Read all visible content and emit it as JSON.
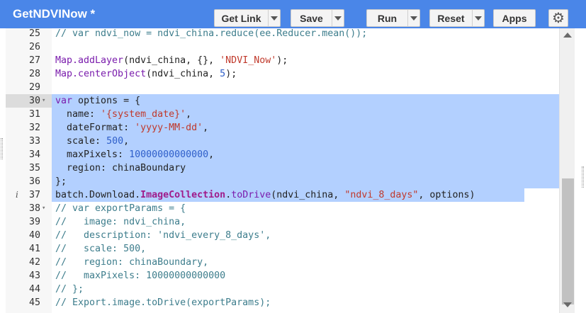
{
  "header": {
    "title": "GetNDVINow *",
    "get_link_label": "Get Link",
    "save_label": "Save",
    "run_label": "Run",
    "reset_label": "Reset",
    "apps_label": "Apps",
    "settings_icon": "gear-icon",
    "color": "#4a86e8"
  },
  "editor": {
    "selection_color": "#b3d0ff",
    "lines": [
      {
        "num": "25",
        "fold": "",
        "marker": "",
        "selected": false,
        "tokens": [
          [
            "com",
            "// var ndvi_now = ndvi_china.reduce(ee.Reducer.mean());"
          ]
        ]
      },
      {
        "num": "26",
        "fold": "",
        "marker": "",
        "selected": false,
        "tokens": []
      },
      {
        "num": "27",
        "fold": "",
        "marker": "",
        "selected": false,
        "tokens": [
          [
            "fn",
            "Map.addLayer"
          ],
          [
            "plain",
            "(ndvi_china, {}, "
          ],
          [
            "str",
            "'NDVI_Now'"
          ],
          [
            "plain",
            ");"
          ]
        ]
      },
      {
        "num": "28",
        "fold": "",
        "marker": "",
        "selected": false,
        "tokens": [
          [
            "fn",
            "Map.centerObject"
          ],
          [
            "plain",
            "(ndvi_china, "
          ],
          [
            "num",
            "5"
          ],
          [
            "plain",
            ");"
          ]
        ]
      },
      {
        "num": "29",
        "fold": "",
        "marker": "",
        "selected": false,
        "tokens": []
      },
      {
        "num": "30",
        "fold": "▾",
        "marker": "",
        "selected": true,
        "tokens": [
          [
            "kw",
            "var"
          ],
          [
            "plain",
            " options = {"
          ]
        ]
      },
      {
        "num": "31",
        "fold": "",
        "marker": "",
        "selected": true,
        "tokens": [
          [
            "plain",
            "  name: "
          ],
          [
            "str",
            "'{system_date}'"
          ],
          [
            "plain",
            ","
          ]
        ]
      },
      {
        "num": "32",
        "fold": "",
        "marker": "",
        "selected": true,
        "tokens": [
          [
            "plain",
            "  dateFormat: "
          ],
          [
            "str",
            "'yyyy-MM-dd'"
          ],
          [
            "plain",
            ","
          ]
        ]
      },
      {
        "num": "33",
        "fold": "",
        "marker": "",
        "selected": true,
        "tokens": [
          [
            "plain",
            "  scale: "
          ],
          [
            "num",
            "500"
          ],
          [
            "plain",
            ","
          ]
        ]
      },
      {
        "num": "34",
        "fold": "",
        "marker": "",
        "selected": true,
        "tokens": [
          [
            "plain",
            "  maxPixels: "
          ],
          [
            "num",
            "10000000000000"
          ],
          [
            "plain",
            ","
          ]
        ]
      },
      {
        "num": "35",
        "fold": "",
        "marker": "",
        "selected": true,
        "tokens": [
          [
            "plain",
            "  region: chinaBoundary"
          ]
        ]
      },
      {
        "num": "36",
        "fold": "",
        "marker": "",
        "selected": true,
        "tokens": [
          [
            "plain",
            "};"
          ]
        ]
      },
      {
        "num": "37",
        "fold": "",
        "marker": "i",
        "selected": true,
        "tokens": [
          [
            "plain",
            "batch.Download."
          ],
          [
            "prop",
            "ImageCollection"
          ],
          [
            "plain",
            "."
          ],
          [
            "fn",
            "toDrive"
          ],
          [
            "plain",
            "(ndvi_china, "
          ],
          [
            "str",
            "\"ndvi_8_days\""
          ],
          [
            "plain",
            ", options)"
          ]
        ]
      },
      {
        "num": "38",
        "fold": "▾",
        "marker": "",
        "selected": false,
        "tokens": [
          [
            "com",
            "// var exportParams = {"
          ]
        ]
      },
      {
        "num": "39",
        "fold": "",
        "marker": "",
        "selected": false,
        "tokens": [
          [
            "com",
            "//   image: ndvi_china,"
          ]
        ]
      },
      {
        "num": "40",
        "fold": "",
        "marker": "",
        "selected": false,
        "tokens": [
          [
            "com",
            "//   description: 'ndvi_every_8_days',"
          ]
        ]
      },
      {
        "num": "41",
        "fold": "",
        "marker": "",
        "selected": false,
        "tokens": [
          [
            "com",
            "//   scale: 500,"
          ]
        ]
      },
      {
        "num": "42",
        "fold": "",
        "marker": "",
        "selected": false,
        "tokens": [
          [
            "com",
            "//   region: chinaBoundary,"
          ]
        ]
      },
      {
        "num": "43",
        "fold": "",
        "marker": "",
        "selected": false,
        "tokens": [
          [
            "com",
            "//   maxPixels: 10000000000000"
          ]
        ]
      },
      {
        "num": "44",
        "fold": "",
        "marker": "",
        "selected": false,
        "tokens": [
          [
            "com",
            "// };"
          ]
        ]
      },
      {
        "num": "45",
        "fold": "",
        "marker": "",
        "selected": false,
        "tokens": [
          [
            "com",
            "// Export.image.toDrive(exportParams);"
          ]
        ]
      }
    ]
  }
}
